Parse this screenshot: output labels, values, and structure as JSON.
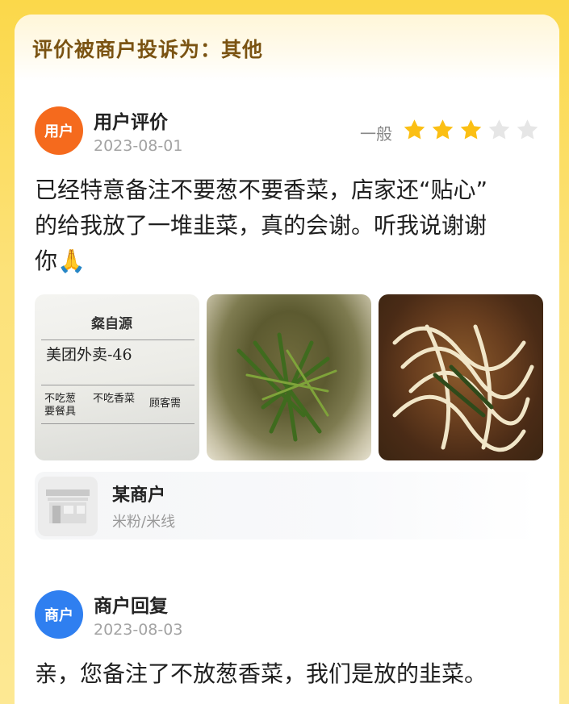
{
  "complaint": {
    "banner": "评价被商户投诉为：其他"
  },
  "review": {
    "avatar_label": "用户",
    "author": "用户评价",
    "date": "2023-08-01",
    "rating_text": "一般",
    "rating": 3,
    "max_rating": 5,
    "line1": "已经特意备注不要葱不要香菜，店家还“贴心”",
    "line2": "的给我放了一堆韭菜，真的会谢。听我说谢谢",
    "line3": "你🙏",
    "photos": [
      {
        "name": "receipt-photo",
        "shop_title": "粲自源",
        "order": "美团外卖-46",
        "note1": "不吃葱",
        "note2": "不吃香菜",
        "note3": "顾客需",
        "note4": "要餐具"
      },
      {
        "name": "food-photo-greens"
      },
      {
        "name": "food-photo-noodles"
      }
    ]
  },
  "shop": {
    "name": "某商户",
    "category": "米粉/米线"
  },
  "reply": {
    "avatar_label": "商户",
    "author": "商户回复",
    "date": "2023-08-03",
    "text": "亲，您备注了不放葱香菜，我们是放的韭菜。"
  },
  "colors": {
    "star_filled": "#fbbf14",
    "star_empty": "#e6e6e6",
    "user_avatar": "#f56a1d",
    "merchant_avatar": "#2f7ff0"
  }
}
